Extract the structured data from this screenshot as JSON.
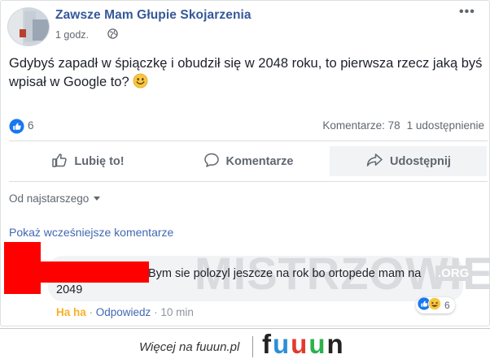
{
  "post": {
    "page_name": "Zawsze Mam Głupie Skojarzenia",
    "time": "1 godz.",
    "privacy_icon": "globe-icon",
    "more_icon": "more-options-icon",
    "text": "Gdybyś zapadł w śpiączkę i obudził się w 2048 roku, to pierwsza rzecz jaką byś wpisał w Google to?"
  },
  "stats": {
    "like_count": "6",
    "comments": "Komentarze: 78",
    "shares": "1 udostępnienie"
  },
  "actions": {
    "like": "Lubię to!",
    "comment": "Komentarze",
    "share": "Udostępnij"
  },
  "comments_section": {
    "sort_label": "Od najstarszego",
    "load_earlier": "Pokaż wcześniejsze komentarze",
    "comment": {
      "text": "Bym sie polozyl jeszcze na rok bo ortopede mam na 2049",
      "reaction_label": "Ha ha",
      "reply_label": "Odpowiedz",
      "time": "10 min",
      "reaction_count": "6"
    }
  },
  "watermark": {
    "text": "MISTRZOWIE",
    "suffix": ".ORG"
  },
  "footer": {
    "text": "Więcej na fuuun.pl",
    "brand": "fuuun"
  },
  "colors": {
    "link": "#365899",
    "like_blue": "#1877f2",
    "haha_yellow": "#f7b125",
    "redaction": "#ff0000",
    "brand_letters": [
      "#222222",
      "#2b8fd6",
      "#e23a2e",
      "#2bb24c",
      "#222222"
    ]
  }
}
